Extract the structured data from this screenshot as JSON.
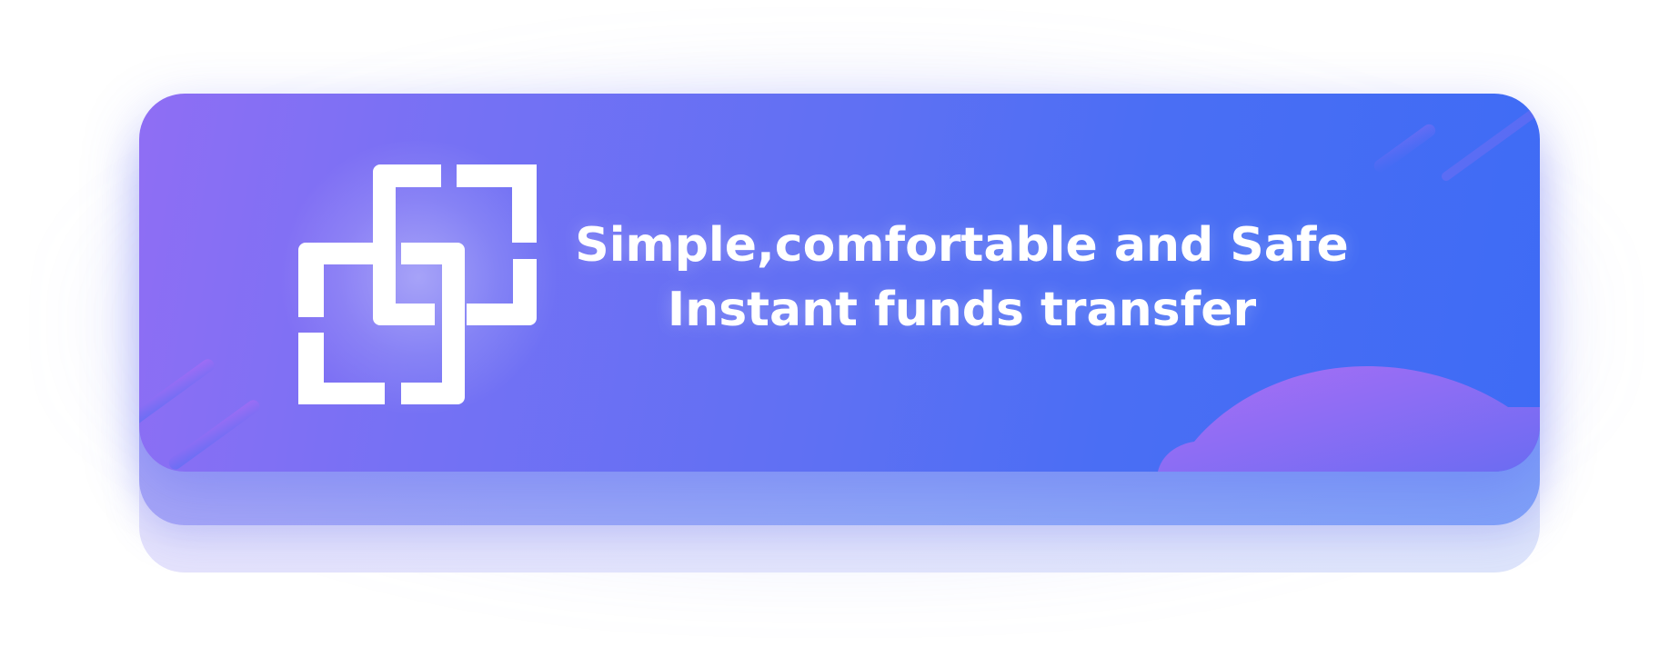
{
  "banner": {
    "headline_line1": "Simple,comfortable and Safe",
    "headline_line2": "Instant funds transfer",
    "logo_icon": "interlocked-brackets-logo-icon"
  },
  "colors": {
    "gradient_start": "#8f6ef4",
    "gradient_end": "#3e6bf5",
    "text": "#ffffff",
    "accent_purple": "#b06ef5"
  }
}
